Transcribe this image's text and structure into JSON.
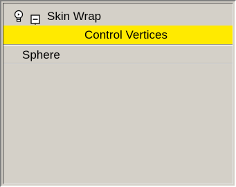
{
  "tree": {
    "items": [
      {
        "label": "Skin Wrap",
        "icon": "lightbulb-icon",
        "expander": "collapse-minus-icon"
      },
      {
        "label": "Control Vertices",
        "selected": true
      },
      {
        "label": "Sphere"
      }
    ]
  },
  "colors": {
    "selection": "#ffea00",
    "panel": "#d4d0c8"
  }
}
